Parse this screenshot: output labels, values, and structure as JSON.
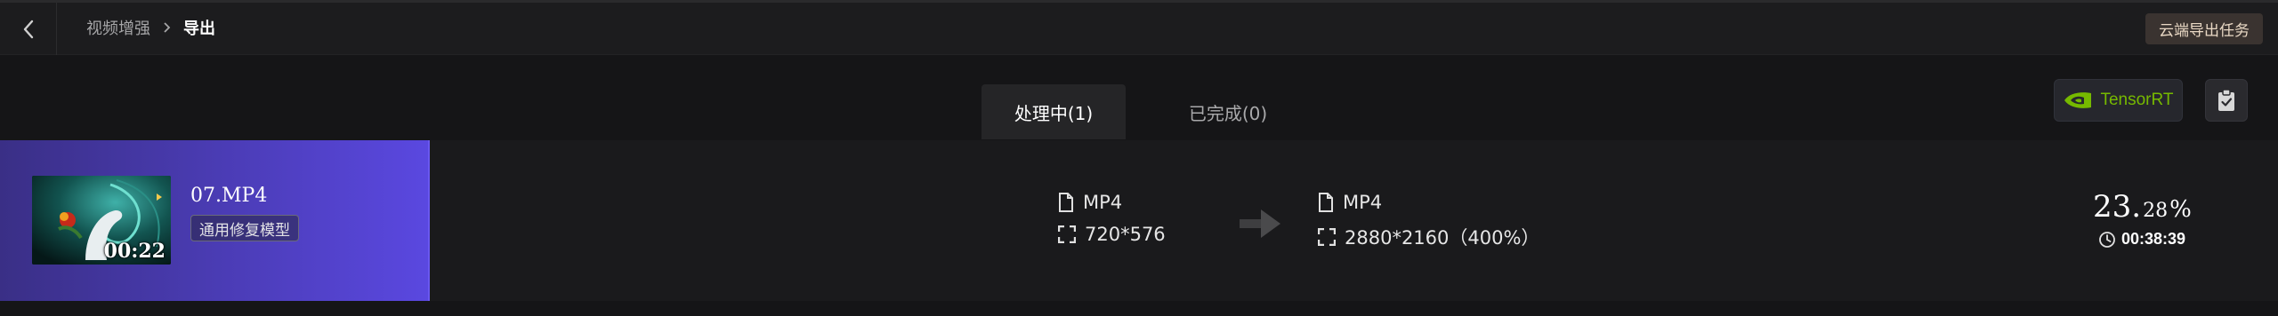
{
  "header": {
    "back_icon": "chevron-left-icon",
    "breadcrumb": {
      "parent": "视频增强",
      "current": "导出"
    },
    "cloud_button_label": "云端导出任务"
  },
  "tabs": [
    {
      "label": "处理中(1)",
      "active": true
    },
    {
      "label": "已完成(0)",
      "active": false
    }
  ],
  "toolbar": {
    "tensorrt_label": "TensorRT",
    "tensorrt_icon": "nvidia-icon",
    "clipboard_icon": "clipboard-icon"
  },
  "task": {
    "filename": "07.MP4",
    "duration": "00:22",
    "model_tag": "通用修复模型",
    "source": {
      "format": "MP4",
      "resolution": "720*576"
    },
    "target": {
      "format": "MP4",
      "resolution": "2880*2160（400%）"
    },
    "progress": {
      "int": "23.",
      "decimal": "28",
      "symbol": "%",
      "value_percent": 23.28
    },
    "remaining_time": "00:38:39"
  },
  "colors": {
    "progress_fill": "#5a48e0",
    "nvidia_green": "#76b900",
    "cloud_button_bg": "#3a3330"
  }
}
